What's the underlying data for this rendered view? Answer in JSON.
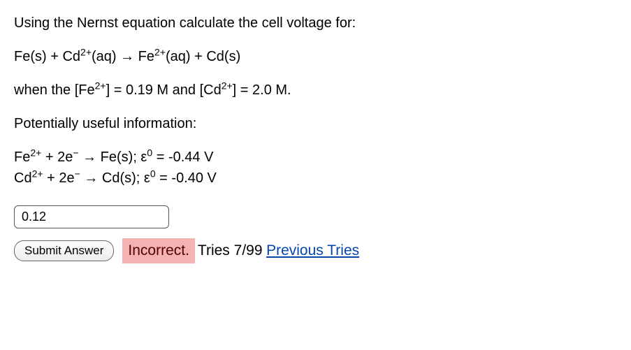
{
  "question": {
    "prompt_prefix": "Using the Nernst equation calculate the cell voltage for:",
    "reaction_prefix": "Fe(s) + Cd",
    "reaction_mid1": "(aq) → Fe",
    "reaction_mid2": "(aq) + Cd(s)",
    "condition_prefix": "when the [Fe",
    "condition_mid1": "] = 0.19 M and [Cd",
    "condition_mid2": "] = 2.0 M.",
    "info_header": "Potentially useful information:",
    "fe_half_pre": "Fe",
    "fe_half_mid1": " + 2e",
    "fe_half_mid2": " → Fe(s); ε",
    "fe_half_post": " = -0.44 V",
    "cd_half_pre": "Cd",
    "cd_half_mid1": " + 2e",
    "cd_half_mid2": " → Cd(s); ε",
    "cd_half_post": " = -0.40 V",
    "sup_2plus": "2+",
    "sup_minus": "−",
    "sup_zero": "0"
  },
  "answer": {
    "value": "0.12"
  },
  "controls": {
    "submit_label": "Submit Answer",
    "incorrect_label": "Incorrect.",
    "tries_label": "Tries 7/99",
    "previous_tries_label": "Previous Tries"
  }
}
